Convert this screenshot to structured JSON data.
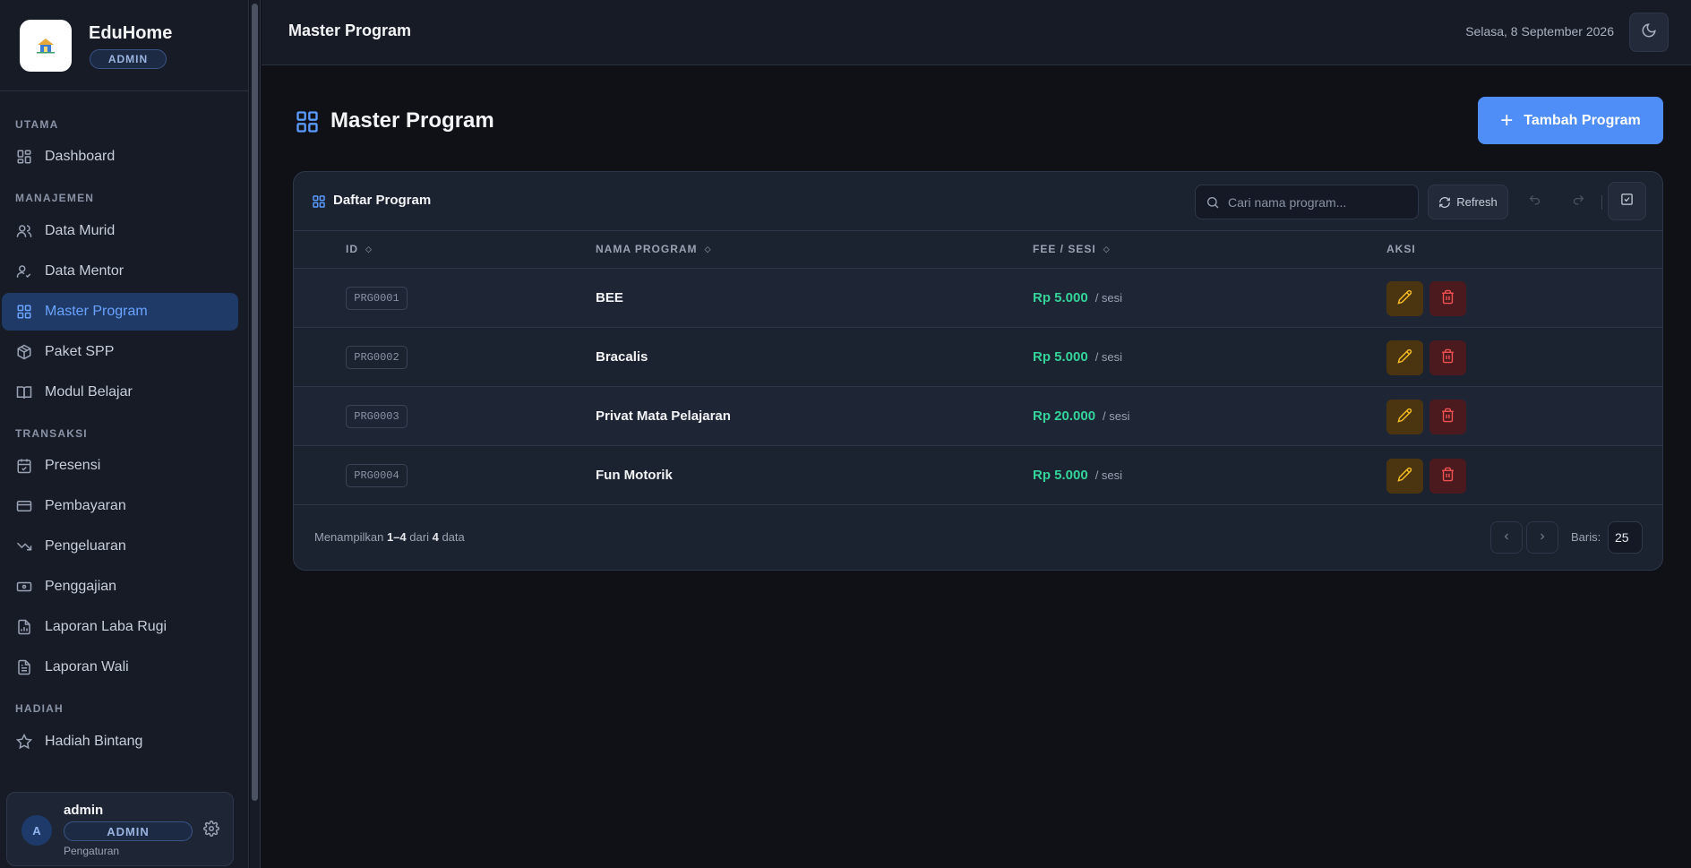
{
  "app": {
    "name": "EduHome",
    "role_badge": "ADMIN"
  },
  "sidebar": {
    "sections": [
      {
        "label": "UTAMA"
      },
      {
        "label": "MANAJEMEN"
      },
      {
        "label": "TRANSAKSI"
      },
      {
        "label": "HADIAH"
      }
    ],
    "items": [
      {
        "label": "Dashboard",
        "icon": "grid-icon"
      },
      {
        "label": "Data Murid",
        "icon": "users-icon"
      },
      {
        "label": "Data Mentor",
        "icon": "user-check-icon"
      },
      {
        "label": "Master Program",
        "icon": "grid-icon",
        "active": true
      },
      {
        "label": "Paket SPP",
        "icon": "package-icon"
      },
      {
        "label": "Modul Belajar",
        "icon": "book-icon"
      },
      {
        "label": "Presensi",
        "icon": "calendar-check-icon"
      },
      {
        "label": "Pembayaran",
        "icon": "credit-card-icon"
      },
      {
        "label": "Pengeluaran",
        "icon": "trending-down-icon"
      },
      {
        "label": "Penggajian",
        "icon": "banknote-icon"
      },
      {
        "label": "Laporan Laba Rugi",
        "icon": "report-chart-icon"
      },
      {
        "label": "Laporan Wali",
        "icon": "file-text-icon"
      },
      {
        "label": "Hadiah Bintang",
        "icon": "star-icon"
      }
    ]
  },
  "user": {
    "avatar_initial": "A",
    "name": "admin",
    "role": "ADMIN",
    "settings_label": "Pengaturan"
  },
  "topbar": {
    "title": "Master Program",
    "date": "Selasa, 8 September 2026"
  },
  "page": {
    "title": "Master Program",
    "add_button": "Tambah Program"
  },
  "table": {
    "title": "Daftar Program",
    "search_placeholder": "Cari nama program...",
    "refresh_label": "Refresh",
    "columns": [
      "ID",
      "NAMA PROGRAM",
      "FEE / SESI",
      "AKSI"
    ],
    "rows": [
      {
        "id": "PRG0001",
        "name": "BEE",
        "fee": "Rp 5.000",
        "unit": "/ sesi"
      },
      {
        "id": "PRG0002",
        "name": "Bracalis",
        "fee": "Rp 5.000",
        "unit": "/ sesi"
      },
      {
        "id": "PRG0003",
        "name": "Privat Mata Pelajaran",
        "fee": "Rp 20.000",
        "unit": "/ sesi"
      },
      {
        "id": "PRG0004",
        "name": "Fun Motorik",
        "fee": "Rp 5.000",
        "unit": "/ sesi"
      }
    ],
    "footer": {
      "prefix": "Menampilkan",
      "range": "1–4",
      "middle": "dari",
      "total": "4",
      "suffix": "data"
    },
    "rows_label": "Baris:",
    "rows_per_page": "25"
  },
  "colors": {
    "accent": "#4f8ef7",
    "fee": "#34d399",
    "edit": "#fbbf24",
    "delete": "#f05252"
  }
}
